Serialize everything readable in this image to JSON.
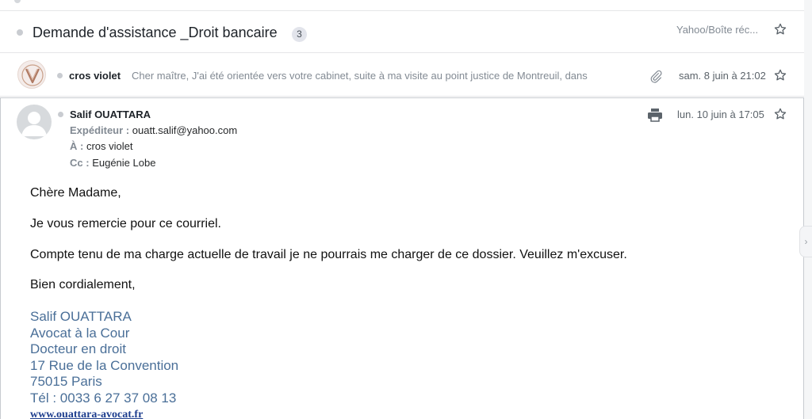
{
  "thread": {
    "subject": "Demande d'assistance _Droit bancaire",
    "message_count": "3",
    "folder": "Yahoo/Boîte réc..."
  },
  "collapsed_message": {
    "sender": "cros violet",
    "snippet": "Cher maître, J'ai été orientée vers votre cabinet, suite à ma visite au point justice de Montreuil, dans",
    "date": "sam. 8 juin à 21:02",
    "has_attachment": true
  },
  "open_message": {
    "sender": "Salif OUATTARA",
    "from_label": "Expéditeur :",
    "from_value": "ouatt.salif@yahoo.com",
    "to_label": "À :",
    "to_value": "cros violet",
    "cc_label": "Cc :",
    "cc_value": "Eugénie Lobe",
    "date": "lun. 10 juin à 17:05",
    "body": {
      "greeting": "Chère Madame,",
      "line1": "Je vous remercie pour ce courriel.",
      "line2": "Compte tenu de ma charge actuelle de travail je ne pourrais me charger de ce dossier. Veuillez m'excuser.",
      "closing": "Bien cordialement,"
    },
    "signature": {
      "name": "Salif OUATTARA",
      "title1": "Avocat à la Cour",
      "title2": "Docteur en droit",
      "address": "17 Rue de la Convention",
      "city": "75015 Paris",
      "phone": "Tél : 0033 6 27 37 08 13",
      "website": "www.ouattara-avocat.fr"
    }
  },
  "icons": {
    "star": "star-outline-icon",
    "attachment": "paperclip-icon",
    "print": "printer-icon",
    "scroll": "chevron-right-icon"
  },
  "colors": {
    "signature": "#4a6f98",
    "link": "#1f3f8f",
    "muted": "#828a93"
  }
}
